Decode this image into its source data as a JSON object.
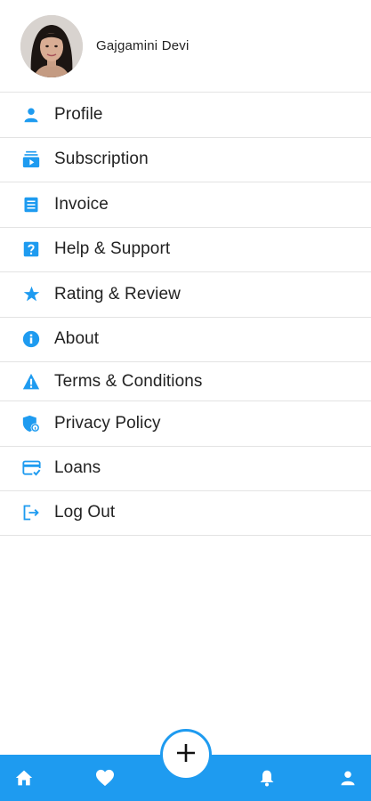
{
  "profile": {
    "name": "Gajgamini Devi"
  },
  "menu": {
    "items": [
      {
        "label": "Profile",
        "icon": "person-icon"
      },
      {
        "label": "Subscription",
        "icon": "subscription-icon"
      },
      {
        "label": "Invoice",
        "icon": "invoice-icon"
      },
      {
        "label": "Help & Support",
        "icon": "help-icon"
      },
      {
        "label": "Rating & Review",
        "icon": "star-icon"
      },
      {
        "label": "About",
        "icon": "info-icon"
      },
      {
        "label": "Terms & Conditions",
        "icon": "warning-icon"
      },
      {
        "label": "Privacy Policy",
        "icon": "privacy-shield-icon"
      },
      {
        "label": "Loans",
        "icon": "card-check-icon"
      },
      {
        "label": "Log Out",
        "icon": "logout-icon"
      }
    ]
  },
  "bottom_nav": {
    "items": [
      "home-icon",
      "heart-icon",
      "plus-icon",
      "bell-icon",
      "person-icon"
    ]
  },
  "colors": {
    "accent": "#1e9bf0",
    "text": "#222222",
    "divider": "#e3e3e3",
    "background": "#ffffff"
  }
}
